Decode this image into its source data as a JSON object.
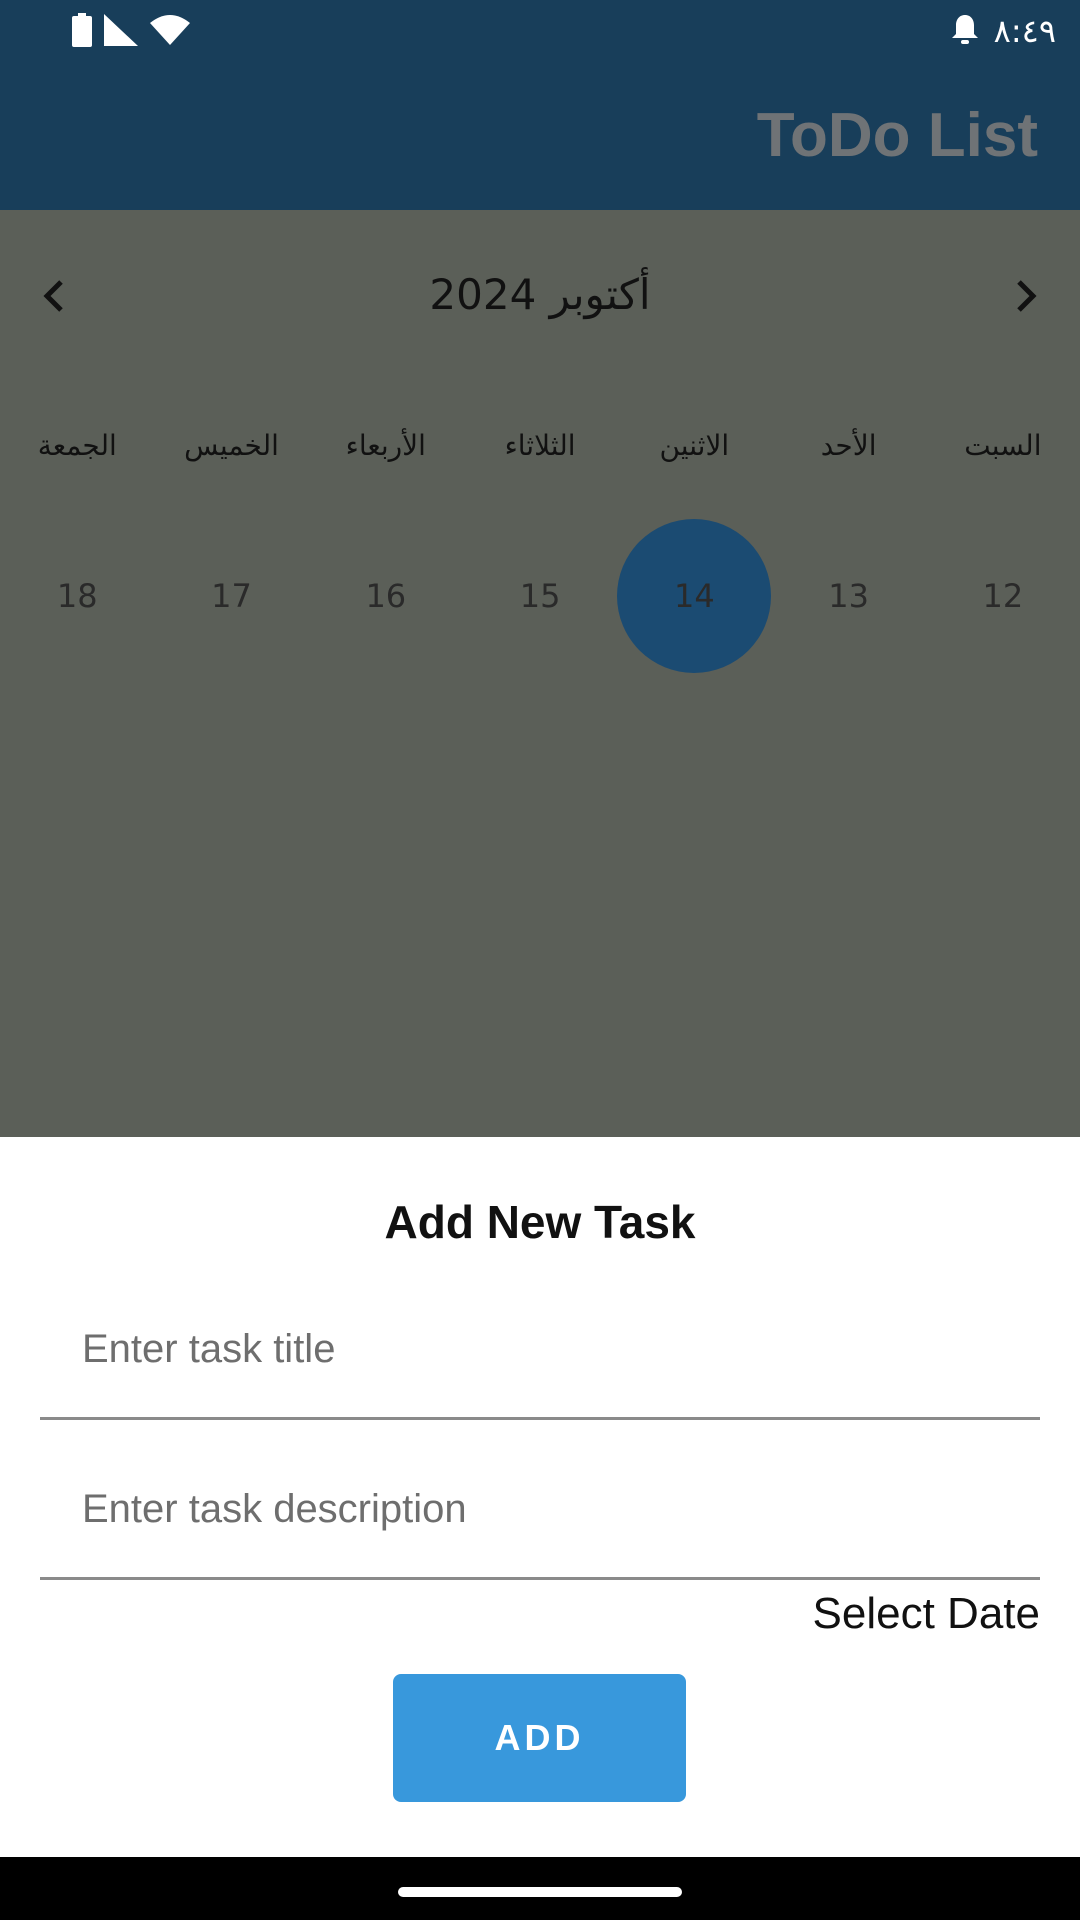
{
  "status_bar": {
    "time": "٨:٤٩",
    "icons": [
      "battery-icon",
      "signal-icon",
      "wifi-icon",
      "notification-bell-icon"
    ]
  },
  "app_bar": {
    "title": "ToDo List"
  },
  "calendar": {
    "month_label": "أكتوبر 2024",
    "prev_icon": "chevron-left-icon",
    "next_icon": "chevron-right-icon",
    "weekdays": [
      "السبت",
      "الأحد",
      "الاثنين",
      "الثلاثاء",
      "الأربعاء",
      "الخميس",
      "الجمعة"
    ],
    "days": [
      "12",
      "13",
      "14",
      "15",
      "16",
      "17",
      "18"
    ],
    "selected_day": "14"
  },
  "sheet": {
    "title": "Add New Task",
    "task_title_placeholder": "Enter task title",
    "task_description_placeholder": "Enter task description",
    "task_title_value": "",
    "task_description_value": "",
    "select_date_label": "Select Date",
    "add_button_label": "ADD"
  },
  "colors": {
    "app_bar": "#183e5a",
    "overlay": "#5b5f58",
    "selected_day": "#1b4b72",
    "add_button": "#3898dc",
    "title_text": "#6f7376"
  }
}
